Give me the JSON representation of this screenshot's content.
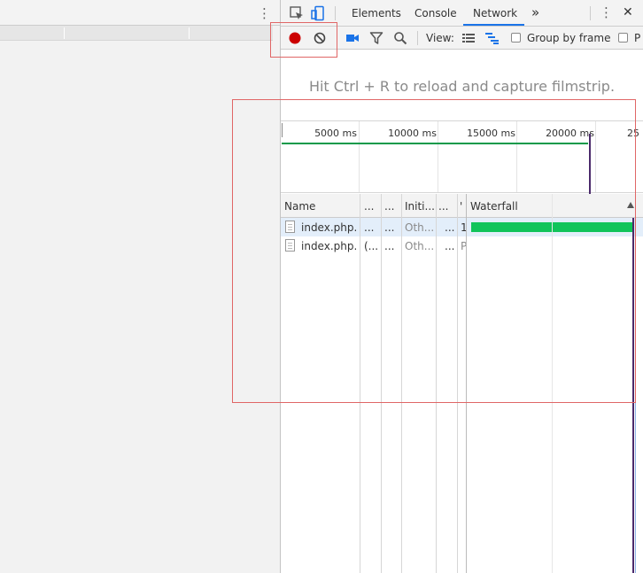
{
  "devtools": {
    "tabs": [
      "Elements",
      "Console",
      "Network"
    ],
    "active_tab": "Network",
    "more_tabs": "»",
    "menu": "⋮",
    "close": "✕"
  },
  "toolbar": {
    "view_label": "View:",
    "group_by_frame_label": "Group by frame",
    "truncated_label": "P"
  },
  "hint": "Hit Ctrl + R to reload and capture filmstrip.",
  "overview": {
    "ticks": [
      "5000 ms",
      "10000 ms",
      "15000 ms",
      "20000 ms",
      "25"
    ]
  },
  "table": {
    "headers": [
      "Name",
      "...",
      "...",
      "Initi...",
      "...",
      "'",
      "Waterfall"
    ],
    "rows": [
      {
        "name": "index.php...",
        "c1": "...",
        "c2": "...",
        "initiator": "Oth...",
        "c4": "...",
        "c5": "1"
      },
      {
        "name": "index.php...",
        "c1": "(...",
        "c2": "...",
        "initiator": "Oth...",
        "c4": "...",
        "c5": "P"
      }
    ]
  },
  "colors": {
    "record": "#cc0000",
    "accent": "#1a73e8",
    "waterfall_bar": "#11c45a",
    "annotation": "#e06666"
  }
}
